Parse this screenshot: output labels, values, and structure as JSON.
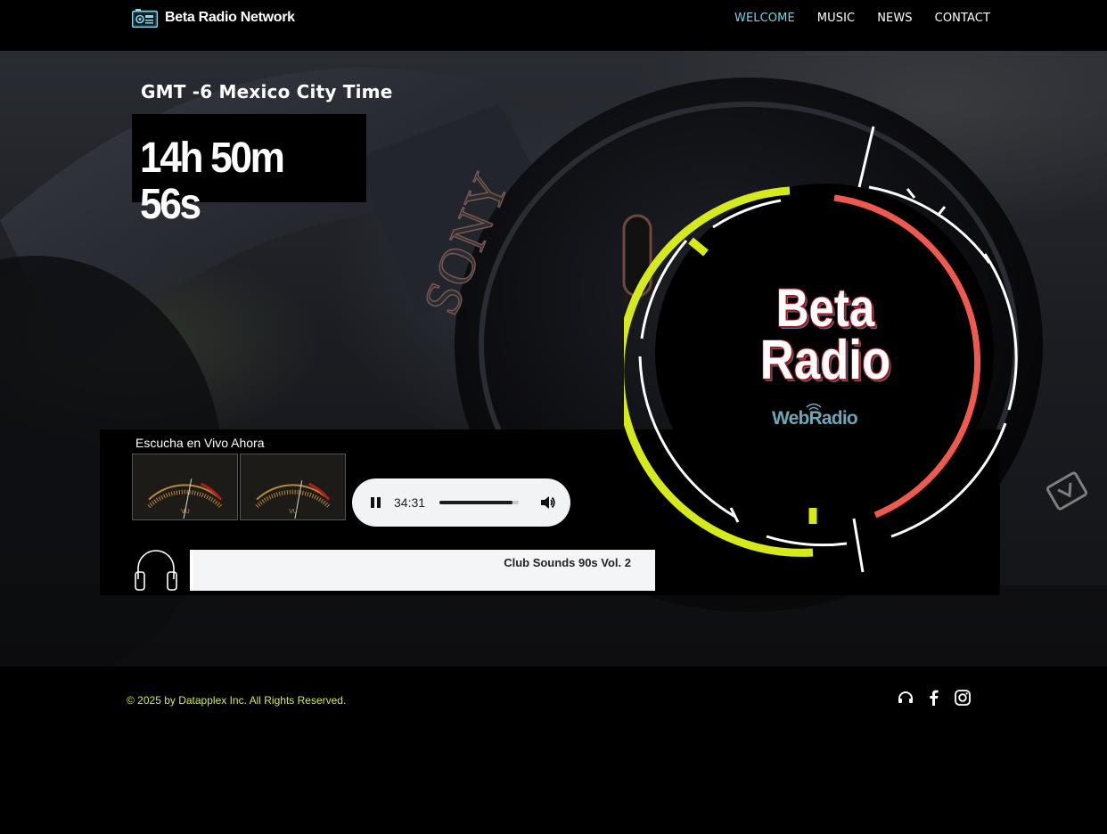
{
  "header": {
    "brand": "Beta Radio Network",
    "nav": [
      {
        "label": "WELCOME",
        "active": true
      },
      {
        "label": "MUSIC",
        "active": false
      },
      {
        "label": "NEWS",
        "active": false
      },
      {
        "label": "CONTACT",
        "active": false
      }
    ]
  },
  "hero": {
    "timezone_label": "GMT -6 Mexico City Time",
    "clock": "14h 50m 56s",
    "background_brand_text": "SONY"
  },
  "player": {
    "live_label": "Escucha en Vivo Ahora",
    "current_time": "34:31",
    "progress_fraction": 0.92,
    "track_title": "Club Sounds 90s Vol. 2"
  },
  "brand_logo": {
    "line1": "Beta",
    "line2": "Radio",
    "sub": "WebRadio"
  },
  "icons": {
    "logo": "radio-icon",
    "pause": "pause-icon",
    "volume": "volume-icon",
    "headphones": "headphones-icon",
    "social": [
      "headphones-icon",
      "facebook-icon",
      "instagram-icon"
    ]
  },
  "colors": {
    "nav_active": "#7ad3e8",
    "ring_left": "#d6ea19",
    "ring_right": "#f05a4e",
    "copyright": "#d5e84f"
  },
  "footer": {
    "copyright": "© 2025 by Datapplex Inc. All Rights Reserved."
  }
}
